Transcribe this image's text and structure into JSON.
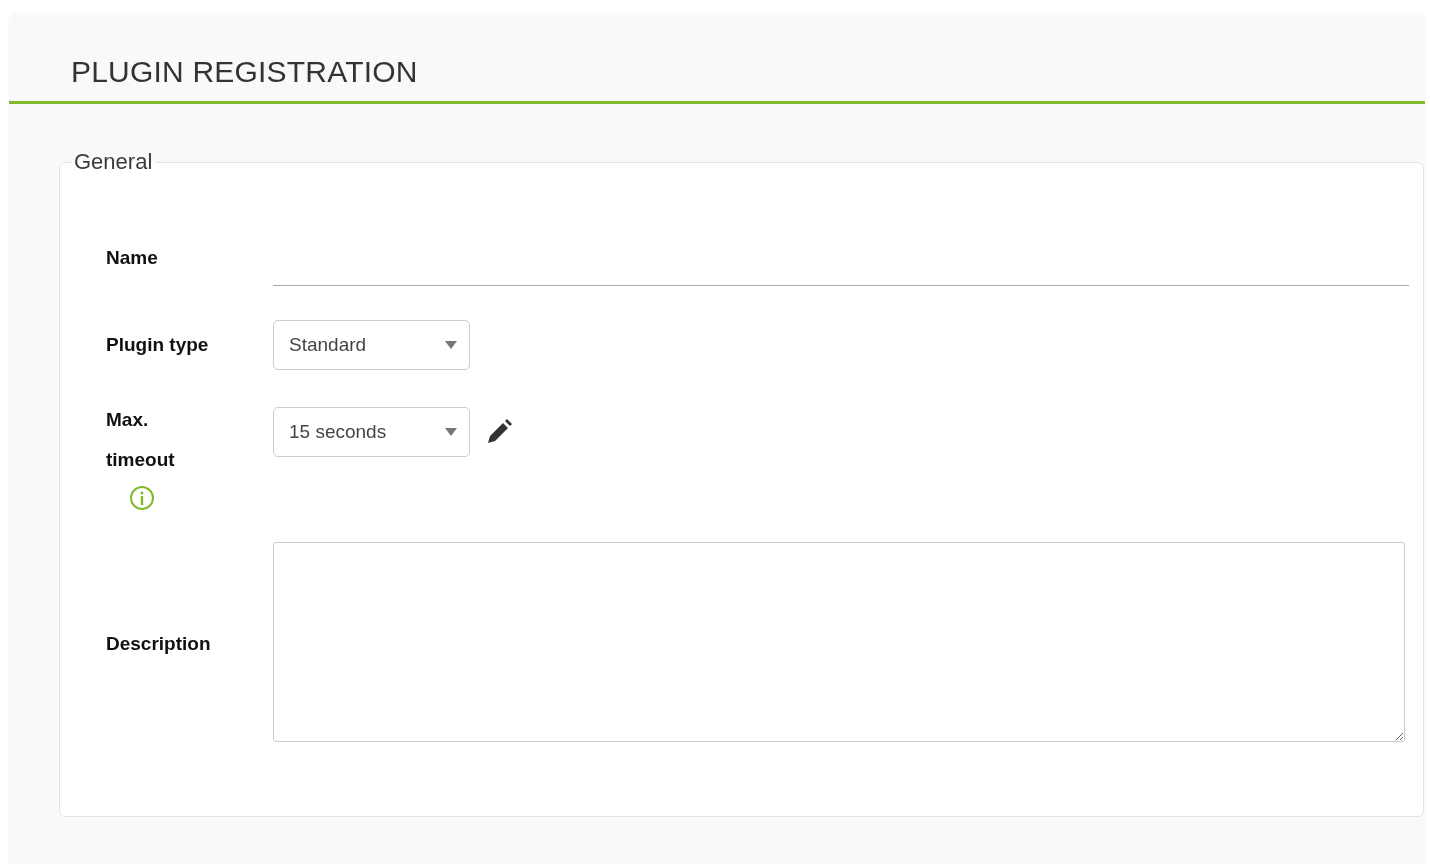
{
  "header": {
    "title": "PLUGIN REGISTRATION"
  },
  "fieldset": {
    "legend": "General",
    "fields": [
      {
        "kind": "text",
        "label": "Name"
      },
      {
        "kind": "select",
        "label": "Plugin type",
        "value": "Standard"
      },
      {
        "kind": "select",
        "label": "Max. timeout",
        "value": "15 seconds",
        "editable": true,
        "info": true
      },
      {
        "kind": "textarea",
        "label": "Description"
      }
    ]
  }
}
